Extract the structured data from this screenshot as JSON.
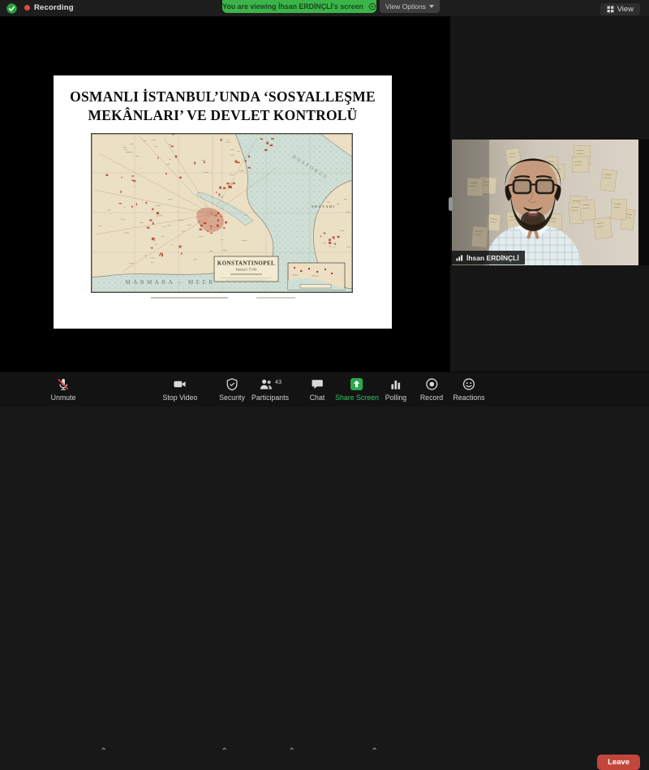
{
  "top_bar": {
    "recording_label": "Recording",
    "banner_text": "You are viewing İhsan ERDİNÇLİ's screen",
    "view_options_label": "View Options",
    "view_button_label": "View"
  },
  "slide": {
    "title_line1": "OSMANLI İSTANBUL’UNDA ‘SOSYALLEŞME",
    "title_line2": "MEKÂNLARI’ VE DEVLET KONTROLÜ",
    "map": {
      "title": "KONSTANTINOPEL",
      "scale_note": "Maßstab 1:75.000",
      "sea_label": "MARMARA - MEER",
      "strait_label": "BOSPORUS",
      "district_label": "SKUTARI"
    }
  },
  "video": {
    "participant_name": "İhsan ERDİNÇLİ"
  },
  "toolbar": {
    "unmute_label": "Unmute",
    "stop_video_label": "Stop Video",
    "security_label": "Security",
    "participants_label": "Participants",
    "participants_count": "43",
    "chat_label": "Chat",
    "share_screen_label": "Share Screen",
    "polling_label": "Polling",
    "record_label": "Record",
    "reactions_label": "Reactions",
    "leave_label": "Leave"
  },
  "colors": {
    "banner_green": "#3bb54a",
    "share_green": "#2ba84e",
    "leave_red": "#c3463b",
    "recording_red": "#e04b3f",
    "screen_bg": "#000000",
    "panel_bg": "#161616"
  }
}
